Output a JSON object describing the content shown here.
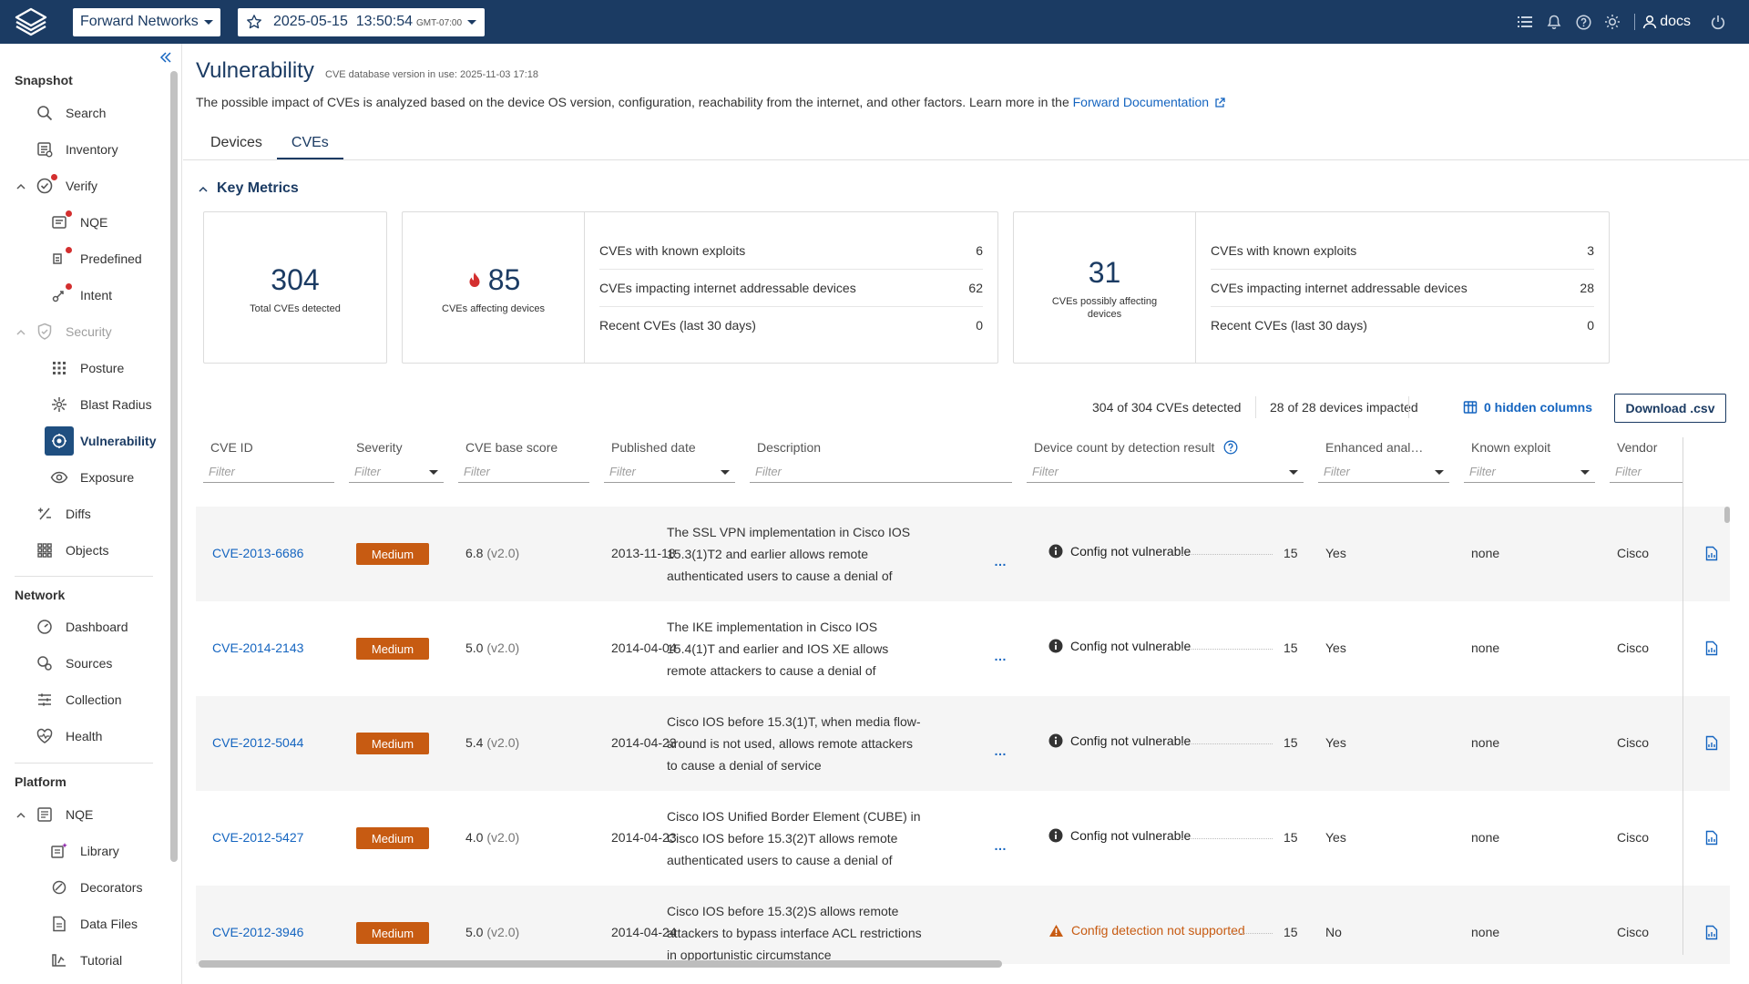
{
  "header": {
    "org": "Forward Networks",
    "snapshot_datetime": "2025-05-15  13:50:54",
    "snapshot_tz": "GMT-07:00",
    "user": "docs"
  },
  "sidebar": {
    "snapshot_heading": "Snapshot",
    "network_heading": "Network",
    "platform_heading": "Platform",
    "items": {
      "search": "Search",
      "inventory": "Inventory",
      "verify": "Verify",
      "nqe": "NQE",
      "predefined": "Predefined",
      "intent": "Intent",
      "security": "Security",
      "posture": "Posture",
      "blast_radius": "Blast Radius",
      "vulnerability": "Vulnerability",
      "exposure": "Exposure",
      "diffs": "Diffs",
      "objects": "Objects",
      "dashboard": "Dashboard",
      "sources": "Sources",
      "collection": "Collection",
      "health": "Health",
      "platform_nqe": "NQE",
      "library": "Library",
      "decorators": "Decorators",
      "data_files": "Data Files",
      "tutorial": "Tutorial"
    }
  },
  "page": {
    "title": "Vulnerability",
    "db_version": "CVE database version in use: 2025-11-03 17:18",
    "description": "The possible impact of CVEs is analyzed based on the device OS version, configuration, reachability from the internet, and other factors. Learn more in the ",
    "doc_link": "Forward Documentation",
    "tabs": [
      "Devices",
      "CVEs"
    ]
  },
  "metrics": {
    "heading": "Key Metrics",
    "total": {
      "value": "304",
      "label": "Total CVEs detected"
    },
    "affecting": {
      "value": "85",
      "label": "CVEs affecting devices",
      "rows": [
        {
          "label": "CVEs with known exploits",
          "value": "6"
        },
        {
          "label": "CVEs impacting internet addressable devices",
          "value": "62"
        },
        {
          "label": "Recent CVEs (last 30 days)",
          "value": "0"
        }
      ]
    },
    "possibly": {
      "value": "31",
      "label": "CVEs possibly affecting devices",
      "rows": [
        {
          "label": "CVEs with known exploits",
          "value": "3"
        },
        {
          "label": "CVEs impacting internet addressable devices",
          "value": "28"
        },
        {
          "label": "Recent CVEs (last 30 days)",
          "value": "0"
        }
      ]
    }
  },
  "summary": {
    "cves_detected": "304 of 304 CVEs detected",
    "devices_impacted": "28 of 28 devices impacted",
    "hidden_columns": "0 hidden columns",
    "download": "Download .csv"
  },
  "table": {
    "columns": [
      "CVE ID",
      "Severity",
      "CVE base score",
      "Published date",
      "Description",
      "Device count by detection result",
      "Enhanced anal…",
      "Known exploit",
      "Vendor"
    ],
    "filter_placeholder": "Filter",
    "rows": [
      {
        "id": "CVE-2013-6686",
        "severity": "Medium",
        "score": "6.8",
        "score_ver": "(v2.0)",
        "date": "2013-11-18",
        "desc": "The SSL VPN implementation in Cisco IOS 15.3(1)T2 and earlier allows remote authenticated users to cause a denial of",
        "detection": "Config not vulnerable",
        "count": "15",
        "enhanced": "Yes",
        "exploit": "none",
        "vendor": "Cisco"
      },
      {
        "id": "CVE-2014-2143",
        "severity": "Medium",
        "score": "5.0",
        "score_ver": "(v2.0)",
        "date": "2014-04-04",
        "desc": "The IKE implementation in Cisco IOS 15.4(1)T and earlier and IOS XE allows remote attackers to cause a denial of",
        "detection": "Config not vulnerable",
        "count": "15",
        "enhanced": "Yes",
        "exploit": "none",
        "vendor": "Cisco"
      },
      {
        "id": "CVE-2012-5044",
        "severity": "Medium",
        "score": "5.4",
        "score_ver": "(v2.0)",
        "date": "2014-04-23",
        "desc": "Cisco IOS before 15.3(1)T, when media flow-around is not used, allows remote attackers to cause a denial of service",
        "detection": "Config not vulnerable",
        "count": "15",
        "enhanced": "Yes",
        "exploit": "none",
        "vendor": "Cisco"
      },
      {
        "id": "CVE-2012-5427",
        "severity": "Medium",
        "score": "4.0",
        "score_ver": "(v2.0)",
        "date": "2014-04-23",
        "desc": "Cisco IOS Unified Border Element (CUBE) in Cisco IOS before 15.3(2)T allows remote authenticated users to cause a denial of",
        "detection": "Config not vulnerable",
        "count": "15",
        "enhanced": "Yes",
        "exploit": "none",
        "vendor": "Cisco"
      },
      {
        "id": "CVE-2012-3946",
        "severity": "Medium",
        "score": "5.0",
        "score_ver": "(v2.0)",
        "date": "2014-04-24",
        "desc": "Cisco IOS before 15.3(2)S allows remote attackers to bypass interface ACL restrictions in opportunistic circumstance",
        "detection": "Config detection not supported",
        "count": "15",
        "enhanced": "No",
        "exploit": "none",
        "vendor": "Cisco"
      }
    ]
  },
  "colors": {
    "brand": "#1b3b63",
    "link": "#1565c0",
    "severity_medium": "#c75b12",
    "alert_dot": "#d32f2f"
  }
}
